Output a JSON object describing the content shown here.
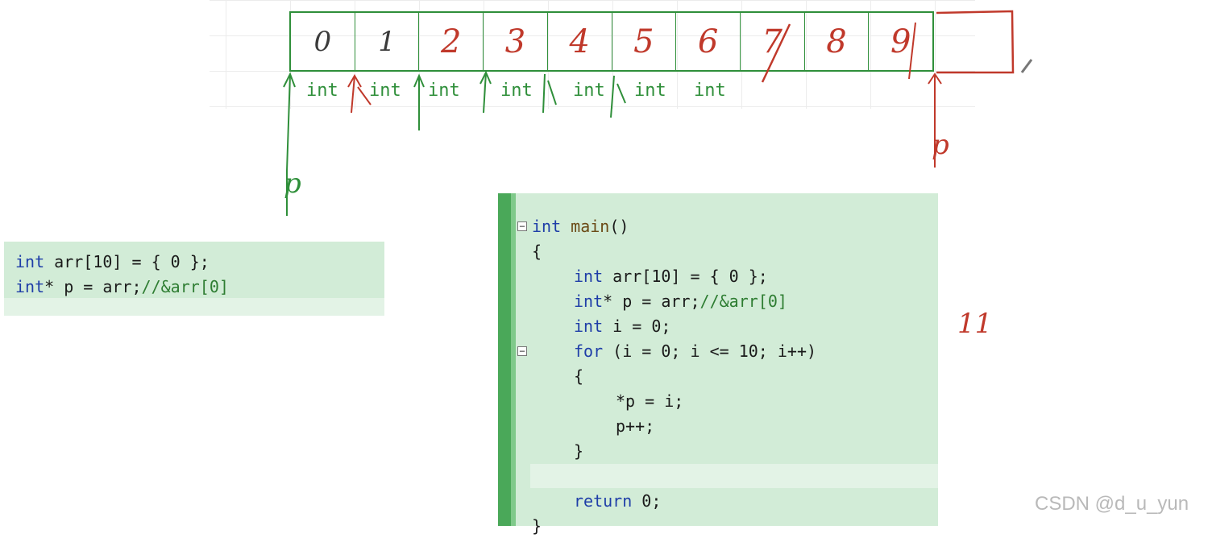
{
  "array_cells": [
    "0",
    "1",
    "2",
    "3",
    "4",
    "5",
    "6",
    "7",
    "8",
    "9",
    ""
  ],
  "int_labels": [
    "int",
    "int",
    "int",
    "int",
    "int",
    "int",
    "int"
  ],
  "pointer_labels": {
    "left": "p",
    "right": "p"
  },
  "note_11": "11",
  "left_code": {
    "line1": {
      "kw": "int",
      "rest": " arr[10] = { 0 };"
    },
    "line2": {
      "kw": "int",
      "rest": "* p = arr;",
      "comment": "//&arr[0]"
    }
  },
  "right_code": {
    "l1": {
      "kw": "int",
      "fn": " main",
      "rest": "()"
    },
    "l2": "{",
    "l3": {
      "kw": "int",
      "rest": " arr[10] = { 0 };"
    },
    "l4": {
      "kw": "int",
      "rest": "* p = arr;",
      "comment": "//&arr[0]"
    },
    "l5": {
      "kw": "int",
      "rest": " i = 0;"
    },
    "l6": {
      "kw": "for",
      "rest": " (i = 0; i <= 10; i++)"
    },
    "l7": "{",
    "l8": "*p = i;",
    "l9": "p++;",
    "l10": "}",
    "l11": "",
    "l12": {
      "kw": "return",
      "rest": " 0;"
    },
    "l13": "}"
  },
  "watermark": "CSDN @d_u_yun",
  "colors": {
    "green": "#2f8f3a",
    "red": "#c0392b",
    "code_bg": "#d2ecd7"
  }
}
